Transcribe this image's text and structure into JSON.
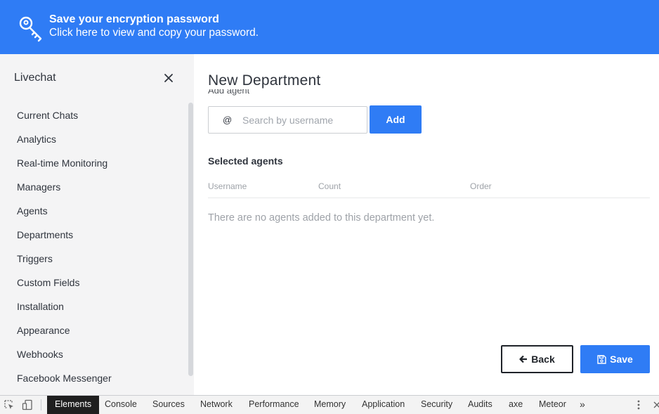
{
  "banner": {
    "title": "Save your encryption password",
    "subtitle": "Click here to view and copy your password.",
    "icon": "key-icon",
    "color": "#2f7cf5"
  },
  "sidebar": {
    "title": "Livechat",
    "close_icon": "close-icon",
    "items": [
      {
        "label": "Current Chats"
      },
      {
        "label": "Analytics"
      },
      {
        "label": "Real-time Monitoring"
      },
      {
        "label": "Managers"
      },
      {
        "label": "Agents"
      },
      {
        "label": "Departments"
      },
      {
        "label": "Triggers"
      },
      {
        "label": "Custom Fields"
      },
      {
        "label": "Installation"
      },
      {
        "label": "Appearance"
      },
      {
        "label": "Webhooks"
      },
      {
        "label": "Facebook Messenger"
      }
    ]
  },
  "main": {
    "page_title": "New Department",
    "add_agent_label": "Add agent",
    "search": {
      "prefix": "@",
      "placeholder": "Search by username",
      "value": ""
    },
    "add_button": "Add",
    "selected_title": "Selected agents",
    "columns": [
      "Username",
      "Count",
      "Order"
    ],
    "empty_message": "There are no agents added to this department yet.",
    "back_button": "Back",
    "save_button": "Save"
  },
  "devtools": {
    "tabs": [
      {
        "label": "Elements",
        "active": true
      },
      {
        "label": "Console"
      },
      {
        "label": "Sources"
      },
      {
        "label": "Network"
      },
      {
        "label": "Performance"
      },
      {
        "label": "Memory"
      },
      {
        "label": "Application"
      },
      {
        "label": "Security"
      },
      {
        "label": "Audits"
      },
      {
        "label": "axe"
      },
      {
        "label": "Meteor"
      }
    ],
    "overflow": "»"
  }
}
